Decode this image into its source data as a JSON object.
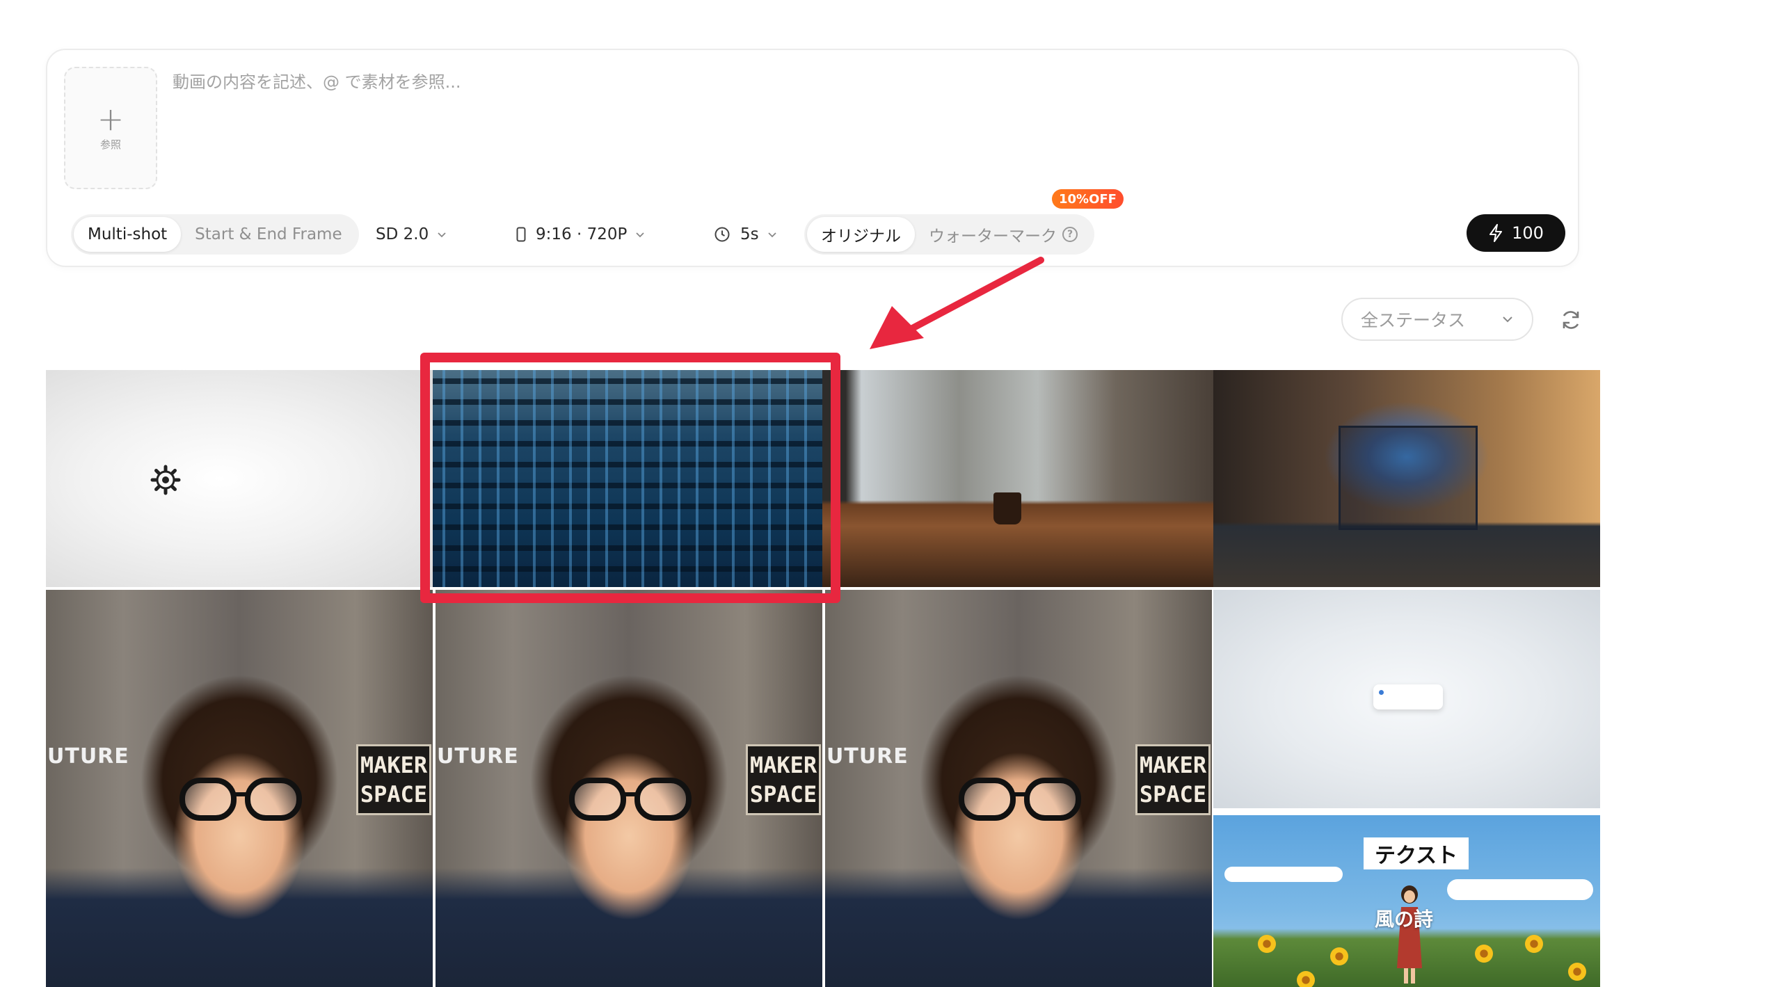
{
  "composer": {
    "reference_label": "参照",
    "prompt_placeholder": "動画の内容を記述、@ で素材を参照...",
    "mode_tabs": [
      {
        "label": "Multi-shot",
        "active": true
      },
      {
        "label": "Start & End Frame",
        "active": false
      }
    ],
    "model": "SD 2.0",
    "aspect_resolution": "9:16 · 720P",
    "duration": "5s",
    "watermark_tabs": [
      {
        "label": "オリジナル",
        "active": true
      },
      {
        "label": "ウォーターマーク",
        "active": false
      }
    ],
    "discount_badge": "10%OFF",
    "generate_credits": "100",
    "help_glyph": "?"
  },
  "filter": {
    "status_label": "全ステータス"
  },
  "gallery": {
    "highlight_color": "#e8273f",
    "tiles": [
      {
        "kind": "blank-with-icon",
        "icon": "gear-icon"
      },
      {
        "kind": "server-hall",
        "highlighted": true
      },
      {
        "kind": "rainy-cafe-window"
      },
      {
        "kind": "laptop-brain"
      },
      {
        "kind": "avatar-maker-space"
      },
      {
        "kind": "avatar-maker-space"
      },
      {
        "kind": "avatar-maker-space"
      },
      {
        "kind": "blank-with-card"
      },
      {
        "kind": "sky-flowers"
      }
    ],
    "avatar_poster_text": "UTURE",
    "avatar_sign_line1": "MAKER",
    "avatar_sign_line2": "SPACE",
    "sky_caption": "テクスト",
    "sky_subtitle": "風の詩"
  }
}
